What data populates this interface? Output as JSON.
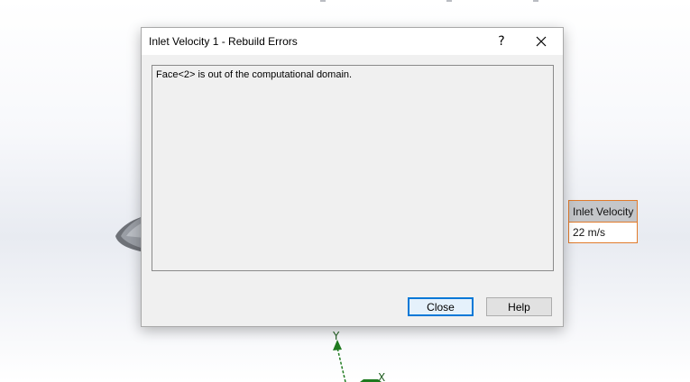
{
  "dialog": {
    "title": "Inlet Velocity 1 - Rebuild Errors",
    "help_glyph": "?",
    "close_icon": "close-icon",
    "message": "Face<2> is out of the computational domain.",
    "buttons": {
      "close_label": "Close",
      "help_label": "Help"
    }
  },
  "callout": {
    "title": "Inlet Velocity",
    "value": "22 m/s",
    "border_color": "#e07b2c"
  },
  "triad": {
    "y_label": "Y",
    "x_label": "X",
    "color": "#1f7a1f"
  },
  "colors": {
    "accent": "#0078d7"
  }
}
